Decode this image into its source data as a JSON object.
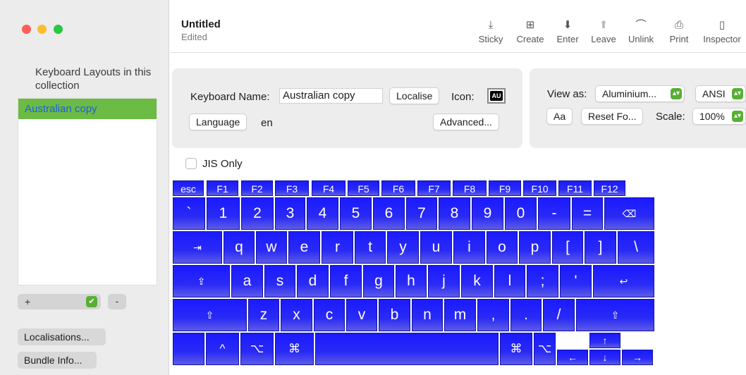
{
  "window": {
    "title": "Untitled",
    "subtitle": "Edited"
  },
  "toolbar": {
    "buttons": [
      {
        "id": "sticky",
        "label": "Sticky",
        "icon": "download-arrow-icon",
        "glyph": "⤓",
        "enabled": true
      },
      {
        "id": "create",
        "label": "Create",
        "icon": "plus-square-icon",
        "glyph": "⊞",
        "enabled": true
      },
      {
        "id": "enter",
        "label": "Enter",
        "icon": "enter-tray-icon",
        "glyph": "⬇",
        "enabled": true
      },
      {
        "id": "leave",
        "label": "Leave",
        "icon": "leave-tray-icon",
        "glyph": "⬆",
        "enabled": false
      },
      {
        "id": "unlink",
        "label": "Unlink",
        "icon": "unlock-icon",
        "glyph": "⌒",
        "enabled": true
      },
      {
        "id": "print",
        "label": "Print",
        "icon": "printer-icon",
        "glyph": "⎙",
        "enabled": true
      },
      {
        "id": "inspector",
        "label": "Inspector",
        "icon": "sidebar-panel-icon",
        "glyph": "▯",
        "enabled": true
      }
    ]
  },
  "sidebar": {
    "heading": "Keyboard Layouts in this collection",
    "layouts": [
      {
        "label": "Australian copy",
        "selected": true
      }
    ],
    "add_label": "+",
    "remove_label": "-",
    "localisations_label": "Localisations...",
    "bundle_info_label": "Bundle Info..."
  },
  "layout_panel": {
    "keyboard_name_label": "Keyboard Name:",
    "keyboard_name_value": "Australian copy",
    "localise_label": "Localise",
    "icon_label": "Icon:",
    "icon_text": "AU",
    "language_label": "Language",
    "language_value": "en",
    "advanced_label": "Advanced..."
  },
  "view_panel": {
    "view_as_label": "View as:",
    "view_as_value": "Aluminium...",
    "standard_value": "ANSI",
    "font_label": "Aa",
    "reset_font_label": "Reset Fo...",
    "scale_label": "Scale:",
    "scale_value": "100%"
  },
  "jis_only": {
    "label": "JIS Only",
    "checked": false
  },
  "keyboard": {
    "function_row": [
      "esc",
      "F1",
      "F2",
      "F3",
      "F4",
      "F5",
      "F6",
      "F7",
      "F8",
      "F9",
      "F10",
      "F11",
      "F12"
    ],
    "number_row": [
      "`",
      "1",
      "2",
      "3",
      "4",
      "5",
      "6",
      "7",
      "8",
      "9",
      "0",
      "-",
      "=",
      "⌫"
    ],
    "top_row": [
      "⇥",
      "q",
      "w",
      "e",
      "r",
      "t",
      "y",
      "u",
      "i",
      "o",
      "p",
      "[",
      "]",
      "\\"
    ],
    "home_row": [
      "⇪",
      "a",
      "s",
      "d",
      "f",
      "g",
      "h",
      "j",
      "k",
      "l",
      ";",
      "'",
      "↩"
    ],
    "shift_row": [
      "⇧",
      "z",
      "x",
      "c",
      "v",
      "b",
      "n",
      "m",
      ",",
      ".",
      "/",
      "⇧"
    ],
    "bottom_row": [
      "",
      "^",
      "⌥",
      "⌘",
      "",
      "⌘",
      "⌥",
      "←",
      "↑",
      "↓",
      "→"
    ]
  },
  "colors": {
    "key_blue": "#2020f8",
    "selection_green": "#6bbb45",
    "selection_text": "#1d5fe0",
    "popup_green": "#56b034"
  }
}
